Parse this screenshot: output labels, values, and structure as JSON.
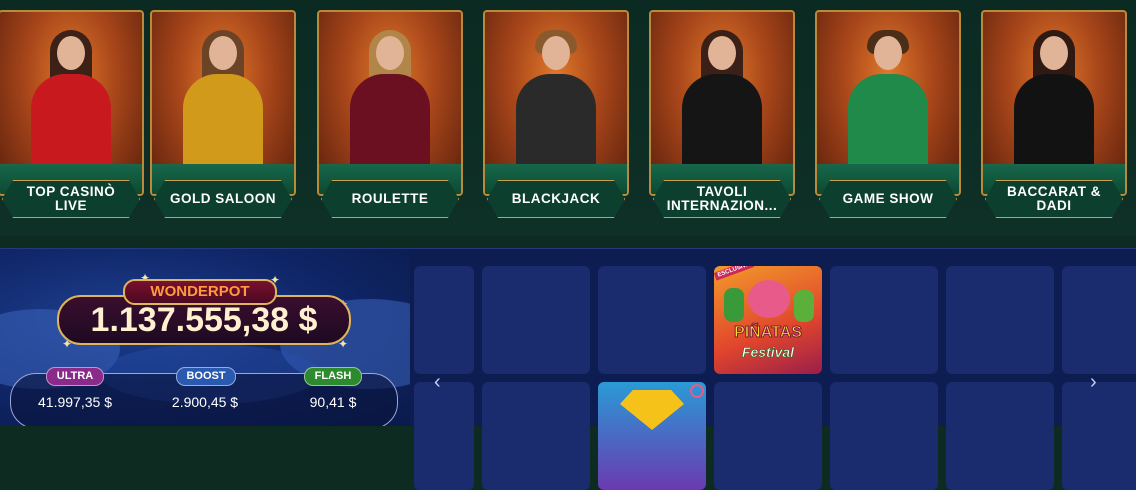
{
  "categories": [
    {
      "label": "TOP CASINÒ LIVE",
      "hair": "#3b2116",
      "dress": "#c81a1e"
    },
    {
      "label": "GOLD SALOON",
      "hair": "#6b4326",
      "dress": "#d19a1a"
    },
    {
      "label": "ROULETTE",
      "hair": "#b28648",
      "dress": "#6b1020"
    },
    {
      "label": "BLACKJACK",
      "hair": "#8a5a2c",
      "dress": "#2a2a2a"
    },
    {
      "label": "TAVOLI INTERNAZION...",
      "hair": "#3a2016",
      "dress": "#151515"
    },
    {
      "label": "GAME SHOW",
      "hair": "#4a2e18",
      "dress": "#1f8a4a"
    },
    {
      "label": "BACCARAT & DADI",
      "hair": "#2e1a12",
      "dress": "#121212"
    }
  ],
  "jackpot": {
    "title": "WONDERPOT",
    "amount": "1.137.555,38 $",
    "tiers": [
      {
        "name": "ULTRA",
        "value": "41.997,35 $",
        "color": "#8a2a8a"
      },
      {
        "name": "BOOST",
        "value": "2.900,45 $",
        "color": "#2a5ab0"
      },
      {
        "name": "FLASH",
        "value": "90,41 $",
        "color": "#2e8a2e"
      }
    ]
  },
  "games": {
    "prev_icon": "chevron-left-icon",
    "next_icon": "chevron-right-icon",
    "prev": "‹",
    "next": "›",
    "featured": {
      "title": "PIÑATAS",
      "subtitle": "Festival",
      "badge": "ESCLUSIVA"
    }
  }
}
